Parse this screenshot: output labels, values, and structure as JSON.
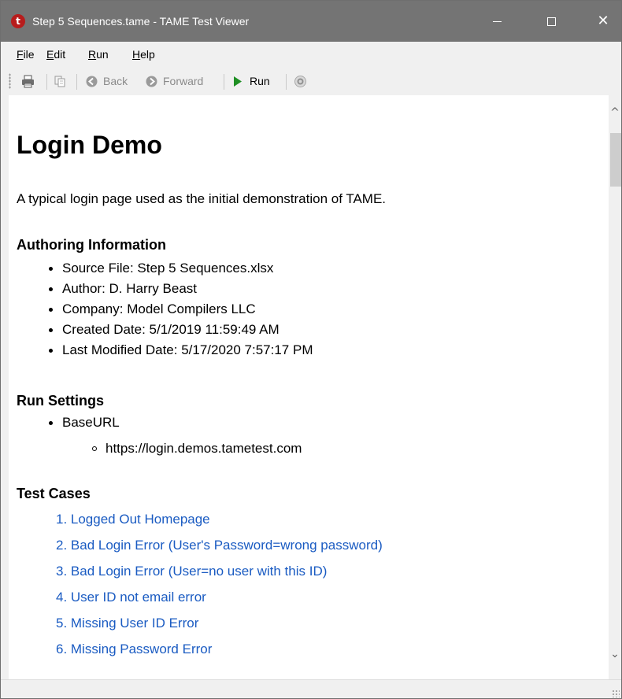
{
  "window": {
    "title": "Step 5 Sequences.tame - TAME Test Viewer",
    "app_icon_letter": "t"
  },
  "menu": {
    "items": [
      {
        "label": "File",
        "access_key": "F"
      },
      {
        "label": "Edit",
        "access_key": "E"
      },
      {
        "label": "Run",
        "access_key": "R"
      },
      {
        "label": "Help",
        "access_key": "H"
      }
    ]
  },
  "toolbar": {
    "back_label": "Back",
    "forward_label": "Forward",
    "run_label": "Run"
  },
  "document": {
    "title": "Login Demo",
    "description": "A typical login page used as the initial demonstration of TAME.",
    "authoring_heading": "Authoring Information",
    "authoring_items": [
      "Source File: Step 5 Sequences.xlsx",
      "Author: D. Harry Beast",
      "Company: Model Compilers LLC",
      "Created Date: 5/1/2019 11:59:49 AM",
      "Last Modified Date: 5/17/2020 7:57:17 PM"
    ],
    "run_settings_heading": "Run Settings",
    "run_settings": [
      {
        "name": "BaseURL",
        "value": "https://login.demos.tametest.com"
      }
    ],
    "test_cases_heading": "Test Cases",
    "test_cases": [
      "1. Logged Out Homepage",
      "2. Bad Login Error (User's Password=wrong password)",
      "3. Bad Login Error (User=no user with this ID)",
      "4. User ID not email error",
      "5. Missing User ID Error",
      "6. Missing Password Error"
    ]
  },
  "colors": {
    "titlebar": "#747474",
    "link": "#1a5bc2",
    "run_green": "#1f8f24",
    "app_icon": "#b71c1c"
  }
}
